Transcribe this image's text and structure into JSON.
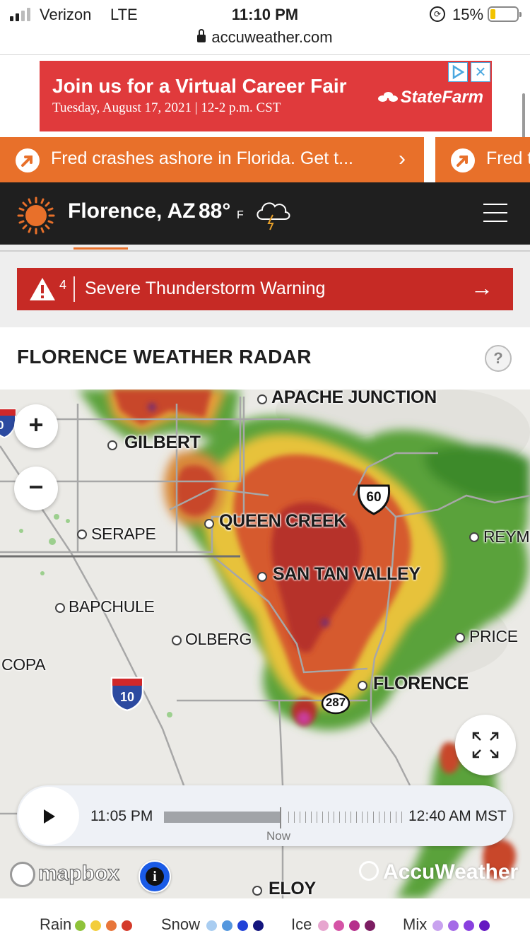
{
  "status_bar": {
    "carrier": "Verizon",
    "network": "LTE",
    "time": "11:10 PM",
    "battery": "15%",
    "url": "accuweather.com"
  },
  "ad": {
    "title": "Join us for a Virtual Career Fair",
    "subtitle": "Tuesday, August 17, 2021 | 12-2 p.m. CST",
    "brand": "StateFarm"
  },
  "ticker": {
    "items": [
      {
        "text": "Fred crashes ashore in Florida. Get t..."
      },
      {
        "text": "Fred t"
      }
    ]
  },
  "header": {
    "location": "Florence, AZ",
    "temperature": "88°",
    "unit": "F"
  },
  "alert": {
    "count": "4",
    "text": "Severe Thunderstorm Warning"
  },
  "radar": {
    "title": "FLORENCE WEATHER RADAR",
    "help": "?"
  },
  "map": {
    "places": [
      "APACHE JUNCTION",
      "GILBERT",
      "QUEEN CREEK",
      "SERAPE",
      "SAN TAN VALLEY",
      "REYME",
      "BAPCHULE",
      "OLBERG",
      "PRICE",
      "COPA",
      "FLORENCE",
      "ELOY"
    ],
    "shields": {
      "us60": "60",
      "i10": "10",
      "i10_left": "0",
      "az287": "287"
    }
  },
  "controls": {
    "zoom_in": "+",
    "zoom_out": "−"
  },
  "timeline": {
    "start": "11:05 PM",
    "end": "12:40 AM MST",
    "now": "Now",
    "progress": 0.48
  },
  "attribution": {
    "mapbox": "mapbox",
    "info": "i",
    "brand": "AccuWeather"
  },
  "legend": [
    {
      "label": "Rain",
      "colors": [
        "#8fc33a",
        "#f3cd3a",
        "#e8763a",
        "#d43a2a"
      ]
    },
    {
      "label": "Snow",
      "colors": [
        "#a9cdf1",
        "#5497de",
        "#2142d8",
        "#14157e"
      ]
    },
    {
      "label": "Ice",
      "colors": [
        "#e7a6cf",
        "#d553a6",
        "#b62f8c",
        "#7c1d62"
      ]
    },
    {
      "label": "Mix",
      "colors": [
        "#c8a2ef",
        "#a56be7",
        "#8940df",
        "#6518c2"
      ]
    }
  ]
}
